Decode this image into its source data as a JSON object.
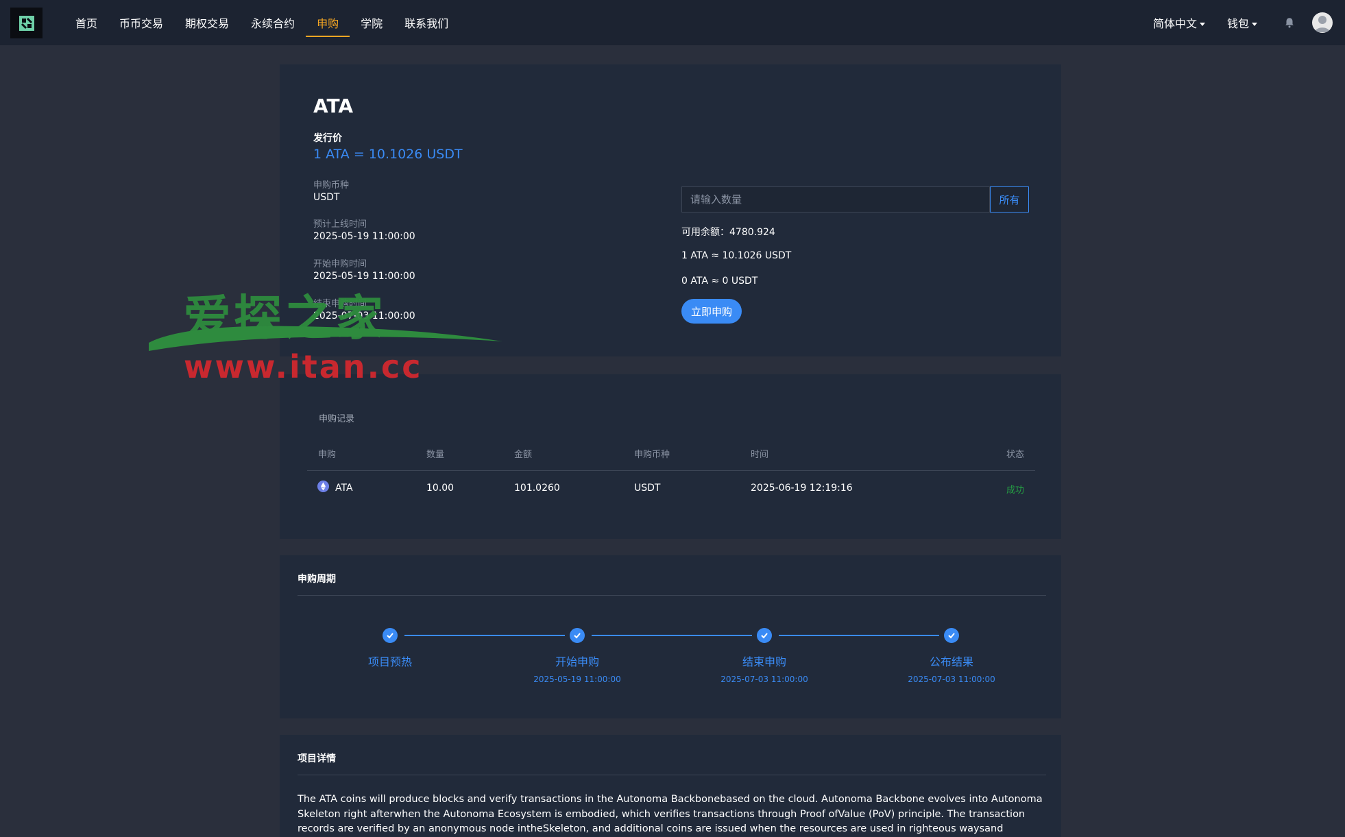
{
  "nav": {
    "items": [
      {
        "label": "首页",
        "active": false
      },
      {
        "label": "币币交易",
        "active": false
      },
      {
        "label": "期权交易",
        "active": false
      },
      {
        "label": "永续合约",
        "active": false
      },
      {
        "label": "申购",
        "active": true
      },
      {
        "label": "学院",
        "active": false
      },
      {
        "label": "联系我们",
        "active": false
      }
    ],
    "language": "简体中文",
    "wallet": "钱包"
  },
  "project": {
    "symbol": "ATA",
    "issue_price_label": "发行价",
    "issue_price": "1 ATA = 10.1026 USDT",
    "currency_label": "申购币种",
    "currency": "USDT",
    "listing_time_label": "预计上线时间",
    "listing_time": "2025-05-19 11:00:00",
    "start_time_label": "开始申购时间",
    "start_time": "2025-05-19 11:00:00",
    "end_time_label": "结束申购时间",
    "end_time": "2025-07-03 11:00:00"
  },
  "subscribe": {
    "qty_placeholder": "请输入数量",
    "all_label": "所有",
    "balance": "可用余额：4780.924",
    "rate": "1 ATA ≈ 10.1026 USDT",
    "estimate": "0 ATA ≈ 0 USDT",
    "submit_label": "立即申购"
  },
  "watermark": {
    "cn": "爱探之家",
    "url": "www.itan.cc"
  },
  "records": {
    "title": "申购记录",
    "headers": [
      "申购",
      "数量",
      "金额",
      "申购币种",
      "时间",
      "状态"
    ],
    "rows": [
      {
        "coin": "ATA",
        "qty": "10.00",
        "amount": "101.0260",
        "currency": "USDT",
        "time": "2025-06-19 12:19:16",
        "status": "成功"
      }
    ]
  },
  "cycle": {
    "title": "申购周期",
    "steps": [
      {
        "label": "项目预热",
        "date": ""
      },
      {
        "label": "开始申购",
        "date": "2025-05-19 11:00:00"
      },
      {
        "label": "结束申购",
        "date": "2025-07-03 11:00:00"
      },
      {
        "label": "公布结果",
        "date": "2025-07-03 11:00:00"
      }
    ]
  },
  "details": {
    "title": "项目详情",
    "text": "The ATA coins will produce blocks and verify transactions in the Autonoma Backbonebased on the cloud. Autonoma Backbone evolves into Autonoma Skeleton right afterwhen the Autonoma Ecosystem is embodied, which verifies transactions through Proof ofValue (PoV) principle. The transaction records are verified by an anonymous node intheSkeleton, and additional coins are issued when the resources are used in righteous waysand purposes. These are for rewarding the realization of"
  },
  "colors": {
    "accent": "#3a8bf5",
    "nav_active": "#f5a623",
    "success": "#25a244",
    "bg": "#2a2f3c",
    "card": "#212a3a",
    "header": "#1c2331"
  }
}
